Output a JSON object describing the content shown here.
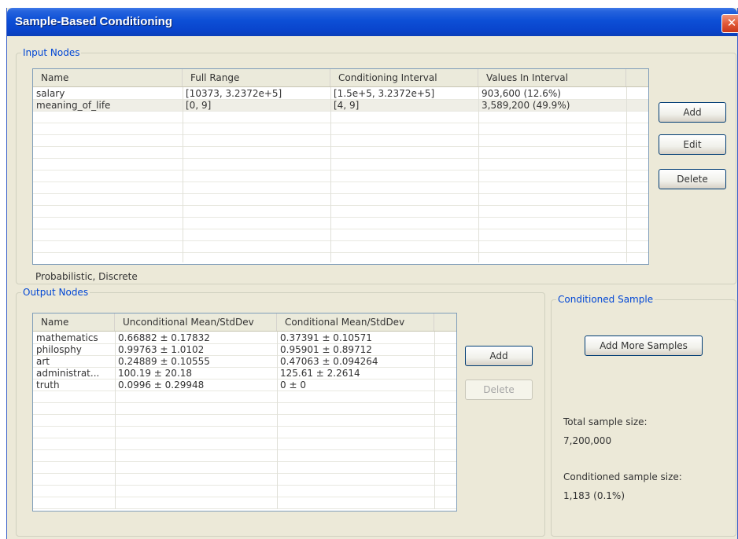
{
  "window": {
    "title": "Sample-Based Conditioning",
    "close_glyph": "✕"
  },
  "input_nodes": {
    "label": "Input Nodes",
    "columns": [
      "Name",
      "Full Range",
      "Conditioning Interval",
      "Values In Interval"
    ],
    "rows": [
      [
        "salary",
        "[10373, 3.2372e+5]",
        "[1.5e+5, 3.2372e+5]",
        "903,600  (12.6%)"
      ],
      [
        "meaning_of_life",
        "[0, 9]",
        "[4, 9]",
        "3,589,200  (49.9%)"
      ]
    ],
    "status": "Probabilistic, Discrete",
    "buttons": {
      "add": "Add",
      "edit": "Edit",
      "delete": "Delete"
    }
  },
  "output_nodes": {
    "label": "Output Nodes",
    "columns": [
      "Name",
      "Unconditional Mean/StdDev",
      "Conditional Mean/StdDev"
    ],
    "rows": [
      [
        "mathematics",
        "0.66882 ± 0.17832",
        "0.37391 ± 0.10571"
      ],
      [
        "philosphy",
        "0.99763 ± 1.0102",
        "0.95901 ± 0.89712"
      ],
      [
        "art",
        "0.24889 ± 0.10555",
        "0.47063 ± 0.094264"
      ],
      [
        "administrat...",
        "100.19 ± 20.18",
        "125.61 ± 2.2614"
      ],
      [
        "truth",
        "0.0996 ± 0.29948",
        "0 ± 0"
      ]
    ],
    "buttons": {
      "add": "Add",
      "delete": "Delete"
    }
  },
  "conditioned_sample": {
    "label": "Conditioned Sample",
    "add_more_button": "Add More Samples",
    "total_label": "Total sample size:",
    "total_value": "7,200,000",
    "conditioned_label": "Conditioned sample size:",
    "conditioned_value": "1,183  (0.1%)"
  }
}
